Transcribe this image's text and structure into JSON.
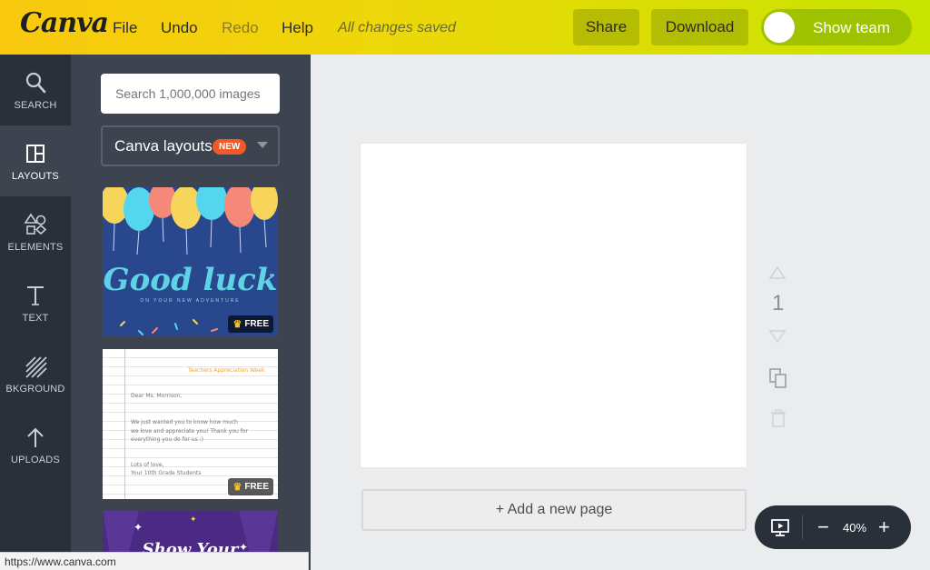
{
  "topbar": {
    "logo": "Canva",
    "menu": [
      "File",
      "Undo",
      "Redo",
      "Help"
    ],
    "saved_status": "All changes saved",
    "share_label": "Share",
    "download_label": "Download",
    "show_team_label": "Show team"
  },
  "rail": {
    "items": [
      {
        "label": "SEARCH",
        "icon": "search-icon"
      },
      {
        "label": "LAYOUTS",
        "icon": "layouts-icon"
      },
      {
        "label": "ELEMENTS",
        "icon": "shapes-icon"
      },
      {
        "label": "TEXT",
        "icon": "text-icon"
      },
      {
        "label": "BKGROUND",
        "icon": "background-icon"
      },
      {
        "label": "UPLOADS",
        "icon": "upload-arrow-icon"
      }
    ],
    "active": "LAYOUTS"
  },
  "panel": {
    "search_placeholder": "Search 1,000,000 images",
    "selector_label": "Canva layouts",
    "selector_badge": "NEW",
    "templates": [
      {
        "title": "Good luck",
        "subtitle": "ON YOUR NEW ADVENTURE",
        "badge": "FREE"
      },
      {
        "heading": "Teachers Appreciation Week",
        "lines": [
          "Dear Ms. Morrison,",
          "We just wanted you to know how much",
          "we love and appreciate you! Thank you for",
          "everything you do for us :)",
          "Lots of love,",
          "Your 10th Grade Students"
        ],
        "badge": "FREE"
      },
      {
        "title": "Show Your"
      }
    ]
  },
  "status_bar": "https://www.canva.com",
  "canvas": {
    "page_number": "1",
    "add_page_label": "+ Add a new page",
    "zoom": "40%",
    "zoom_minus": "−",
    "zoom_plus": "+"
  },
  "colors": {
    "topbar_start": "#f9c80e",
    "topbar_end": "#c7e400",
    "rail_bg": "#293039",
    "panel_bg": "#3d4450",
    "badge_new": "#f05a28",
    "canvas_bg": "#ebecee"
  }
}
